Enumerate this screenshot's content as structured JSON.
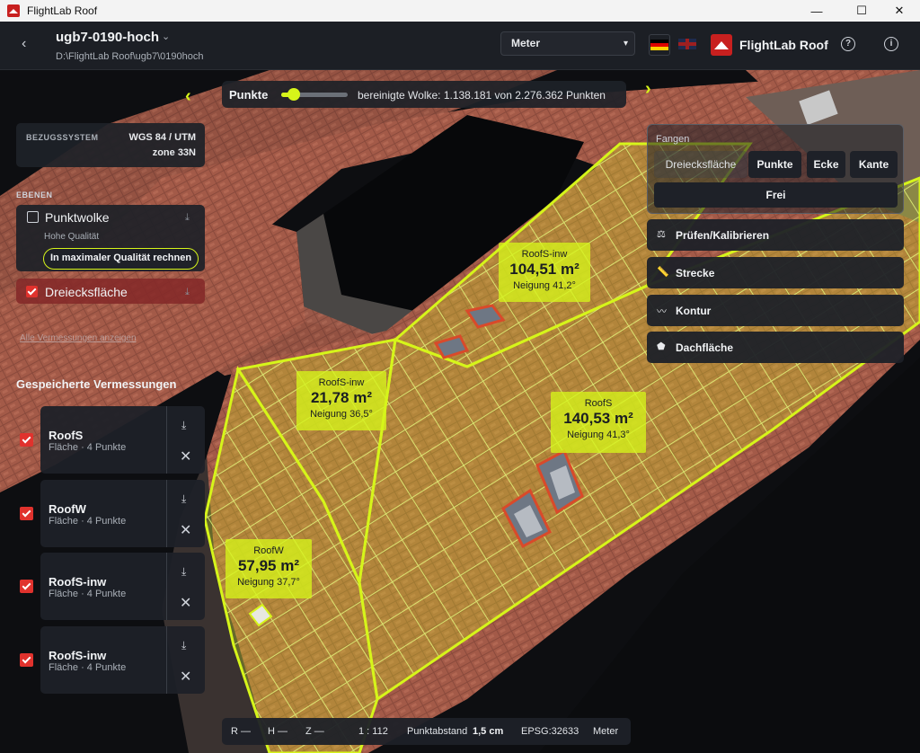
{
  "window": {
    "title": "FlightLab Roof",
    "minimize": "—",
    "maximize": "☐",
    "close": "✕"
  },
  "header": {
    "back": "‹",
    "project": "ugb7-0190-hoch",
    "chevron": "⌄",
    "path": "D:\\FlightLab Roof\\ugb7\\0190hoch",
    "unit_selected": "Meter",
    "brand": "FlightLab Roof",
    "help": "?",
    "info": "i"
  },
  "pointbar": {
    "label": "Punkte",
    "info": "bereinigte Wolke: 1.138.181 von 2.276.362 Punkten",
    "nav_left": "‹",
    "nav_right": "›",
    "slider_fraction": 0.1
  },
  "bezug": {
    "label": "BEZUGSSYSTEM",
    "value1": "WGS 84 / UTM",
    "value2": "zone 33N"
  },
  "layers": {
    "section": "EBENEN",
    "pointcloud": {
      "name": "Punktwolke",
      "sub": "Hohe Qualität",
      "button": "In maximaler Qualität rechnen",
      "download": "⤓"
    },
    "mesh": {
      "name": "Dreiecksfläche",
      "download": "⤓"
    },
    "show_all": "Alle Vermessungen anzeigen"
  },
  "saved": {
    "title": "Gespeicherte Vermessungen",
    "download": "⤓",
    "remove": "✕",
    "items": [
      {
        "name": "RoofS",
        "sub": "Fläche · 4 Punkte"
      },
      {
        "name": "RoofW",
        "sub": "Fläche · 4 Punkte"
      },
      {
        "name": "RoofS-inw",
        "sub": "Fläche · 4 Punkte"
      },
      {
        "name": "RoofS-inw",
        "sub": "Fläche · 4 Punkte"
      }
    ]
  },
  "snap": {
    "label": "Fangen",
    "options": [
      "Dreiecksfläche",
      "Punkte",
      "Ecke",
      "Kante"
    ],
    "free": "Frei"
  },
  "tools": [
    {
      "icon": "⚖",
      "label": "Prüfen/Kalibrieren"
    },
    {
      "icon": "📏",
      "label": "Strecke"
    },
    {
      "icon": "〰",
      "label": "Kontur"
    },
    {
      "icon": "⬟",
      "label": "Dachfläche"
    }
  ],
  "roof_labels": [
    {
      "name": "RoofS-inw",
      "area": "104,51 m²",
      "slope": "Neigung 41,2°"
    },
    {
      "name": "RoofS-inw",
      "area": "21,78 m²",
      "slope": "Neigung 36,5°"
    },
    {
      "name": "RoofS",
      "area": "140,53 m²",
      "slope": "Neigung 41,3°"
    },
    {
      "name": "RoofW",
      "area": "57,95 m²",
      "slope": "Neigung 37,7°"
    }
  ],
  "status": {
    "r": "R —",
    "h": "H —",
    "z": "Z —",
    "scale": "1 : 112",
    "spacing_label": "Punktabstand",
    "spacing_value": "1,5 cm",
    "epsg": "EPSG:32633",
    "unit": "Meter"
  },
  "colors": {
    "accent": "#d6f51a",
    "danger": "#e0322d",
    "brand": "#c8201f",
    "panel": "#1e2128"
  }
}
